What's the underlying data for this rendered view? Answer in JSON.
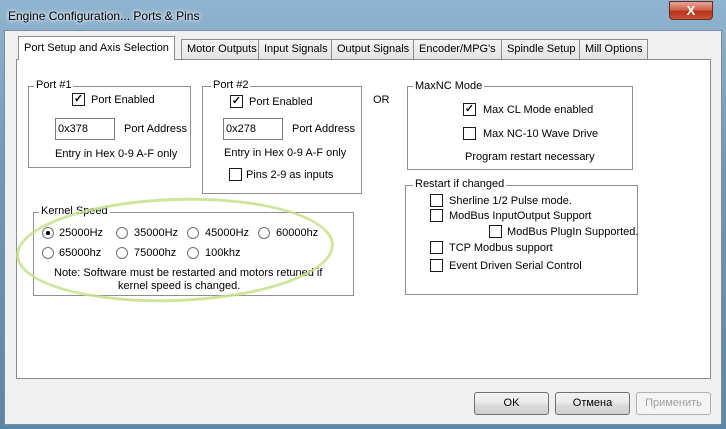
{
  "window": {
    "title": "Engine Configuration... Ports & Pins",
    "close_glyph": "X"
  },
  "tabs": [
    {
      "label": "Port Setup and Axis Selection",
      "active": true
    },
    {
      "label": "Motor Outputs"
    },
    {
      "label": "Input Signals"
    },
    {
      "label": "Output Signals"
    },
    {
      "label": "Encoder/MPG's"
    },
    {
      "label": "Spindle Setup"
    },
    {
      "label": "Mill Options"
    }
  ],
  "port1": {
    "title": "Port #1",
    "enabled_label": "Port Enabled",
    "enabled": true,
    "address_value": "0x378",
    "address_label": "Port Address",
    "hint": "Entry in Hex 0-9 A-F only"
  },
  "port2": {
    "title": "Port #2",
    "enabled_label": "Port Enabled",
    "enabled": true,
    "address_value": "0x278",
    "address_label": "Port Address",
    "hint": "Entry in Hex 0-9 A-F only",
    "pins_label": "Pins 2-9 as inputs",
    "pins_checked": false
  },
  "or_label": "OR",
  "maxnc": {
    "title": "MaxNC Mode",
    "cl_label": "Max CL Mode enabled",
    "cl_checked": true,
    "wave_label": "Max NC-10 Wave Drive",
    "wave_checked": false,
    "note": "Program restart necessary"
  },
  "restart": {
    "title": "Restart if changed",
    "sherline": "Sherline 1/2 Pulse mode.",
    "modbus_io": "ModBus InputOutput Support",
    "modbus_plugin": "ModBus PlugIn Supported.",
    "tcp_modbus": "TCP Modbus support",
    "event_serial": "Event Driven Serial Control"
  },
  "kernel": {
    "title": "Kernel Speed",
    "options": [
      "25000Hz",
      "35000Hz",
      "45000Hz",
      "60000hz",
      "65000hz",
      "75000hz",
      "100khz"
    ],
    "selected": "25000Hz",
    "note_line1": "Note: Software must be restarted and motors retuned if",
    "note_line2": "kernel speed is changed."
  },
  "buttons": {
    "ok": "OK",
    "cancel": "Отмена",
    "apply": "Применить"
  },
  "colors": {
    "highlight": "#c6e28a",
    "close": "#c9533a"
  }
}
